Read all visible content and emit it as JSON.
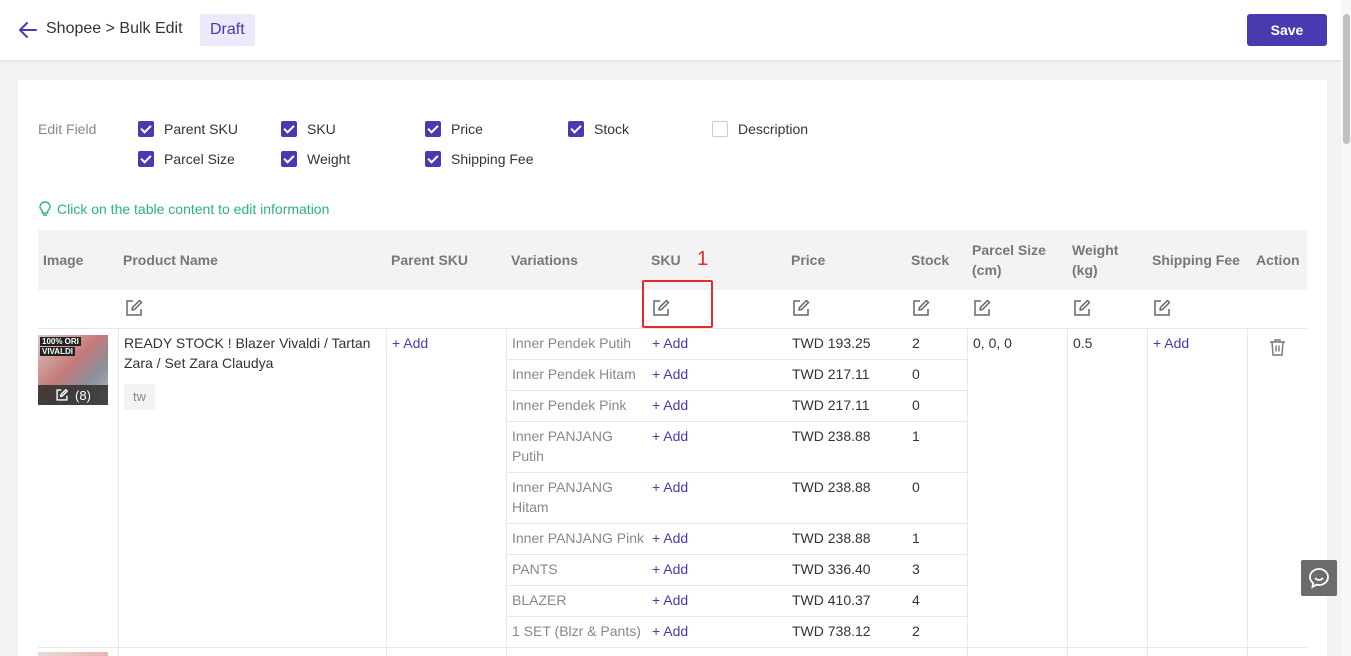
{
  "header": {
    "breadcrumb": "Shopee > Bulk Edit",
    "status_badge": "Draft",
    "save_label": "Save"
  },
  "edit_fields": {
    "label": "Edit Field",
    "options": [
      {
        "label": "Parent SKU",
        "checked": true
      },
      {
        "label": "SKU",
        "checked": true
      },
      {
        "label": "Price",
        "checked": true
      },
      {
        "label": "Stock",
        "checked": true
      },
      {
        "label": "Description",
        "checked": false
      },
      {
        "label": "Parcel Size",
        "checked": true
      },
      {
        "label": "Weight",
        "checked": true
      },
      {
        "label": "Shipping Fee",
        "checked": true
      }
    ]
  },
  "tip": "Click on the table content to edit information",
  "annotation": {
    "marker": "1"
  },
  "table": {
    "columns": {
      "image": "Image",
      "product_name": "Product Name",
      "parent_sku": "Parent SKU",
      "variations": "Variations",
      "sku": "SKU",
      "price": "Price",
      "stock": "Stock",
      "parcel_size_l1": "Parcel Size",
      "parcel_size_l2": "(cm)",
      "weight_l1": "Weight",
      "weight_l2": "(kg)",
      "shipping_fee": "Shipping Fee",
      "action": "Action"
    },
    "product": {
      "image_count": "(8)",
      "image_text_1": "100% ORI",
      "image_text_2": "VIVALDI",
      "name_line1": "READY STOCK ! Blazer Vivaldi / Tartan",
      "name_line2": "Zara / Set Zara Claudya",
      "region_tag": "tw",
      "parent_sku_add": "+ Add",
      "parcel_size": "0,  0,  0",
      "weight": "0.5",
      "shipping_fee_add": "+ Add"
    },
    "variations": [
      {
        "name_l1": "Inner Pendek Putih",
        "name_l2": "",
        "sku": "+ Add",
        "price": "TWD 193.25",
        "stock": "2"
      },
      {
        "name_l1": "Inner Pendek Hitam",
        "name_l2": "",
        "sku": "+ Add",
        "price": "TWD 217.11",
        "stock": "0"
      },
      {
        "name_l1": "Inner Pendek Pink",
        "name_l2": "",
        "sku": "+ Add",
        "price": "TWD 217.11",
        "stock": "0"
      },
      {
        "name_l1": "Inner PANJANG",
        "name_l2": "Putih",
        "sku": "+ Add",
        "price": "TWD 238.88",
        "stock": "1"
      },
      {
        "name_l1": "Inner PANJANG",
        "name_l2": "Hitam",
        "sku": "+ Add",
        "price": "TWD 238.88",
        "stock": "0"
      },
      {
        "name_l1": "Inner PANJANG Pink",
        "name_l2": "",
        "sku": "+ Add",
        "price": "TWD 238.88",
        "stock": "1"
      },
      {
        "name_l1": "PANTS",
        "name_l2": "",
        "sku": "+ Add",
        "price": "TWD 336.40",
        "stock": "3"
      },
      {
        "name_l1": "BLAZER",
        "name_l2": "",
        "sku": "+ Add",
        "price": "TWD 410.37",
        "stock": "4"
      },
      {
        "name_l1": "1 SET (Blzr & Pants)",
        "name_l2": "",
        "sku": "+ Add",
        "price": "TWD 738.12",
        "stock": "2"
      }
    ]
  },
  "colors": {
    "accent": "#4a3ab0",
    "tip": "#2bb08a",
    "annotation": "#e62a2a"
  }
}
